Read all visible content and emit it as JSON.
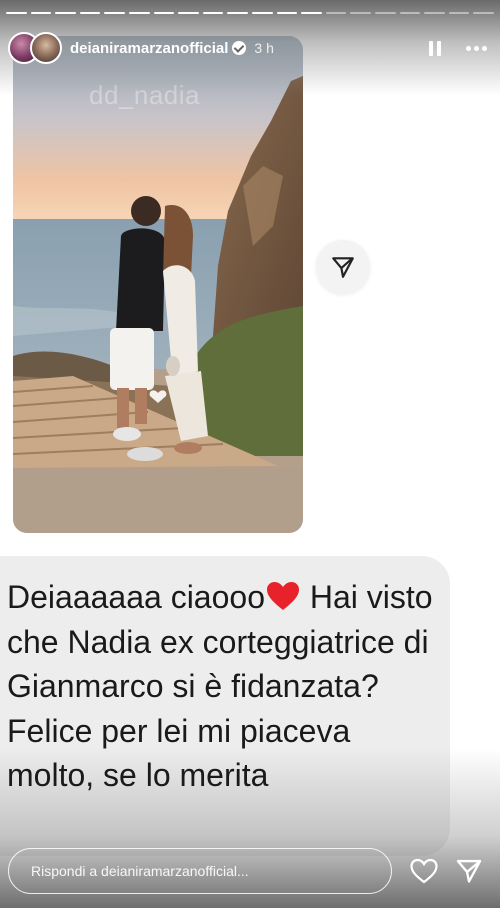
{
  "story": {
    "progress_segments": 20,
    "progress_done": 13,
    "header": {
      "username": "deianiramarzanofficial",
      "verified": true,
      "time": "3 h",
      "pause_icon": "pause-icon",
      "more_icon": "more-icon"
    },
    "shared_post": {
      "username_watermark": "dd_nadia",
      "share_icon": "send-icon"
    },
    "message": {
      "line1": "Deiaaaaaa ciaooo",
      "line1_after": " Hai visto che Nadia ex corteggiatrice di Gianmarco si è fidanzata? Felice per lei mi piaceva molto, se lo merita",
      "emoji": "red-heart"
    },
    "reply": {
      "placeholder": "Rispondi a deianiramarzanofficial...",
      "like_icon": "heart-icon",
      "send_icon": "send-icon"
    }
  },
  "colors": {
    "message_bg": "#ededed",
    "heart": "#e8222b",
    "text": "#1a1a1a"
  }
}
